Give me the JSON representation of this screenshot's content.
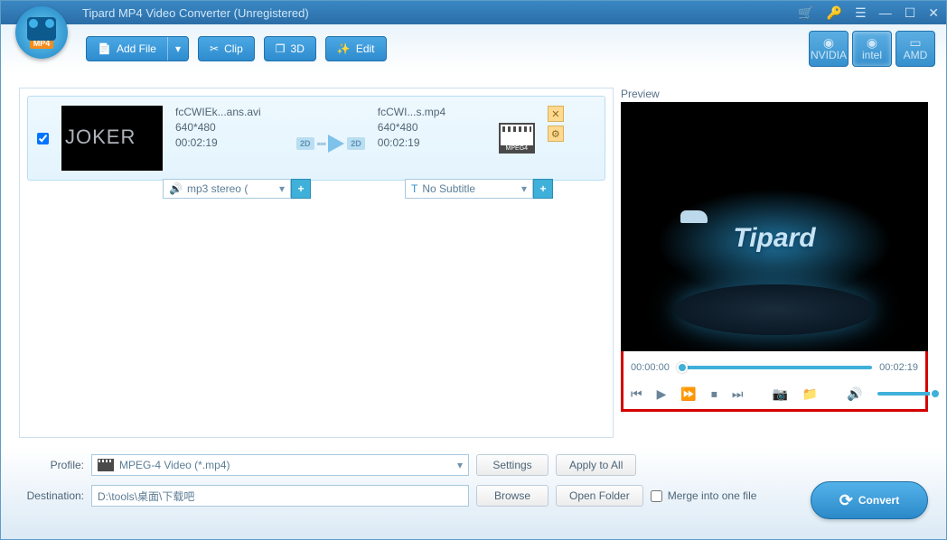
{
  "titlebar": {
    "title": "Tipard MP4 Video Converter (Unregistered)"
  },
  "logo": {
    "badge": "MP4"
  },
  "toolbar": {
    "add_file": "Add File",
    "clip": "Clip",
    "three_d": "3D",
    "edit": "Edit"
  },
  "gpu": {
    "nvidia": "NVIDIA",
    "intel": "intel",
    "amd": "AMD"
  },
  "file": {
    "src_name": "fcCWIEk...ans.avi",
    "src_res": "640*480",
    "src_dur": "00:02:19",
    "dst_name": "fcCWI...s.mp4",
    "dst_res": "640*480",
    "dst_dur": "00:02:19",
    "mpeg_label": "MPEG4",
    "badge2d": "2D",
    "audio_sel": "mp3 stereo (",
    "subtitle_sel": "No Subtitle"
  },
  "preview": {
    "label": "Preview",
    "logo_text": "Tipard",
    "time_start": "00:00:00",
    "time_end": "00:02:19"
  },
  "bottom": {
    "profile_label": "Profile:",
    "profile_value": "MPEG-4 Video (*.mp4)",
    "settings": "Settings",
    "apply_all": "Apply to All",
    "dest_label": "Destination:",
    "dest_value": "D:\\tools\\桌面\\下载吧",
    "browse": "Browse",
    "open_folder": "Open Folder",
    "merge": "Merge into one file",
    "convert": "Convert"
  }
}
